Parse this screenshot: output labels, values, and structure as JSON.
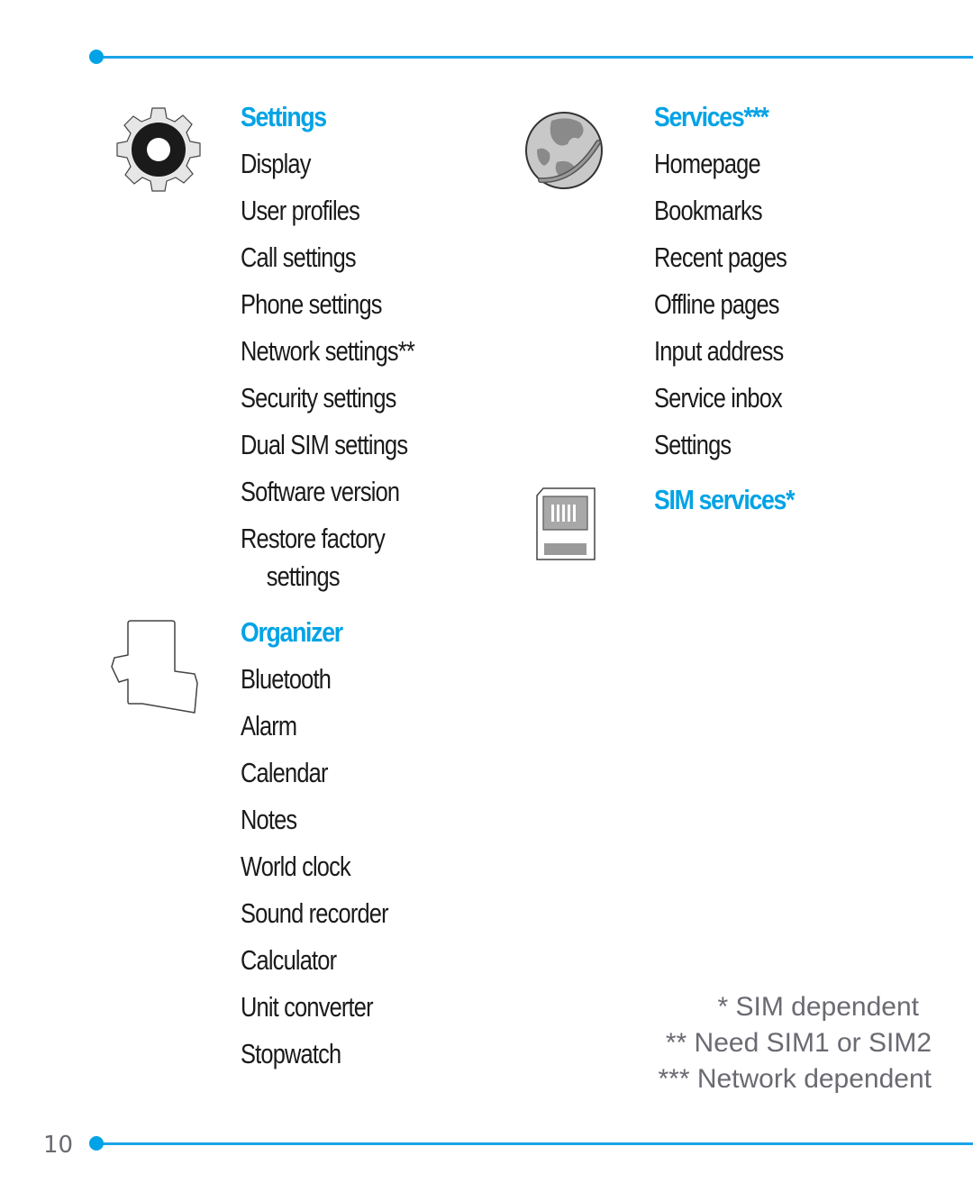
{
  "page_number": "10",
  "sections": {
    "settings": {
      "heading": "Settings",
      "icon": "gear-icon",
      "items": [
        "Display",
        "User profiles",
        "Call settings",
        "Phone settings",
        "Network settings**",
        "Security settings",
        "Dual SIM settings",
        "Software version",
        "Restore factory",
        "settings"
      ]
    },
    "organizer": {
      "heading": "Organizer",
      "icon": "organizer-icon",
      "items": [
        "Bluetooth",
        "Alarm",
        "Calendar",
        "Notes",
        "World clock",
        "Sound recorder",
        "Calculator",
        "Unit converter",
        "Stopwatch"
      ]
    },
    "services": {
      "heading": "Services***",
      "icon": "globe-icon",
      "items": [
        "Homepage",
        "Bookmarks",
        "Recent pages",
        "Offline pages",
        "Input address",
        "Service inbox",
        "Settings"
      ]
    },
    "sim_services": {
      "heading": "SIM services*",
      "icon": "sim-card-icon"
    }
  },
  "footnotes": [
    "* SIM dependent",
    "** Need SIM1 or SIM2",
    "*** Network dependent"
  ],
  "colors": {
    "accent": "#00a3e6",
    "text": "#1a1a1a",
    "footnote": "#6a6a72"
  }
}
